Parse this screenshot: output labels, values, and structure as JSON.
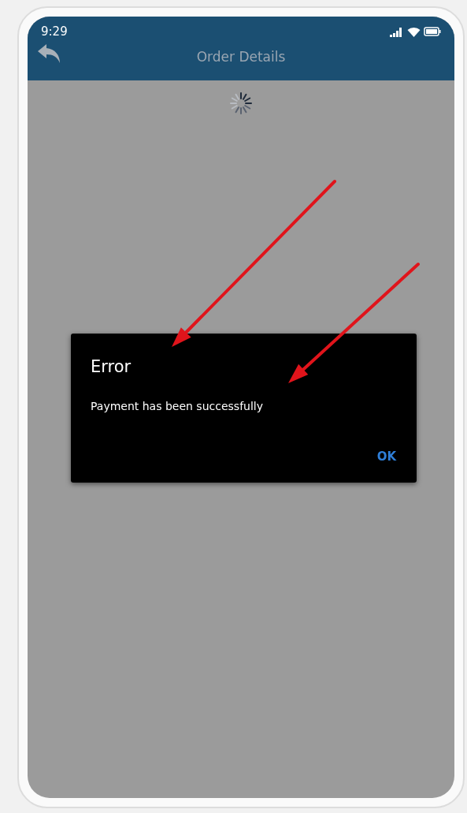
{
  "status_bar": {
    "time": "9:29"
  },
  "header": {
    "title": "Order Details"
  },
  "dialog": {
    "title": "Error",
    "message": "Payment has been successfully",
    "buttons": [
      "OK"
    ]
  }
}
